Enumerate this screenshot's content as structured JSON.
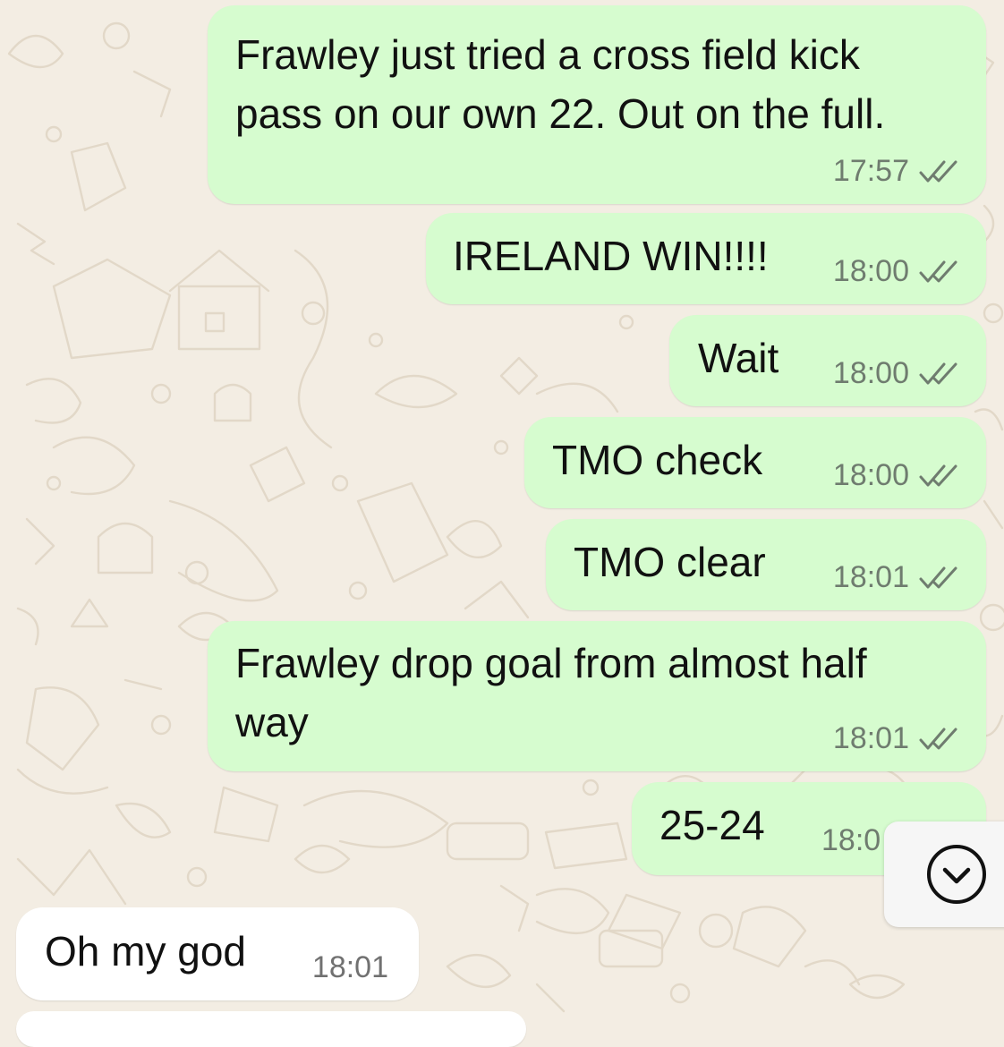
{
  "chat": {
    "messages": [
      {
        "direction": "outgoing",
        "text_lines": [
          "Frawley just tried a cross field kick",
          "pass on our own 22. Out on the full."
        ],
        "time": "17:57",
        "status": "read-double-check-icon"
      },
      {
        "direction": "outgoing",
        "text": "IRELAND WIN!!!!",
        "time": "18:00",
        "status": "read-double-check-icon"
      },
      {
        "direction": "outgoing",
        "text": "Wait",
        "time": "18:00",
        "status": "read-double-check-icon"
      },
      {
        "direction": "outgoing",
        "text": "TMO check",
        "time": "18:00",
        "status": "read-double-check-icon"
      },
      {
        "direction": "outgoing",
        "text": "TMO clear",
        "time": "18:01",
        "status": "read-double-check-icon"
      },
      {
        "direction": "outgoing",
        "text_lines": [
          "Frawley drop goal from almost half",
          "way"
        ],
        "time": "18:01",
        "status": "read-double-check-icon"
      },
      {
        "direction": "outgoing",
        "text": "25-24",
        "time": "18:0",
        "status": "read-double-check-icon"
      },
      {
        "direction": "incoming",
        "text": "Oh my god",
        "time": "18:01"
      }
    ],
    "scroll_button": {
      "icon": "chevron-down-circle-icon"
    }
  },
  "colors": {
    "wallpaper": "#f3ede3",
    "outgoing_bubble": "#d6fccf",
    "incoming_bubble": "#ffffff",
    "meta_text": "#6f7c6f"
  }
}
